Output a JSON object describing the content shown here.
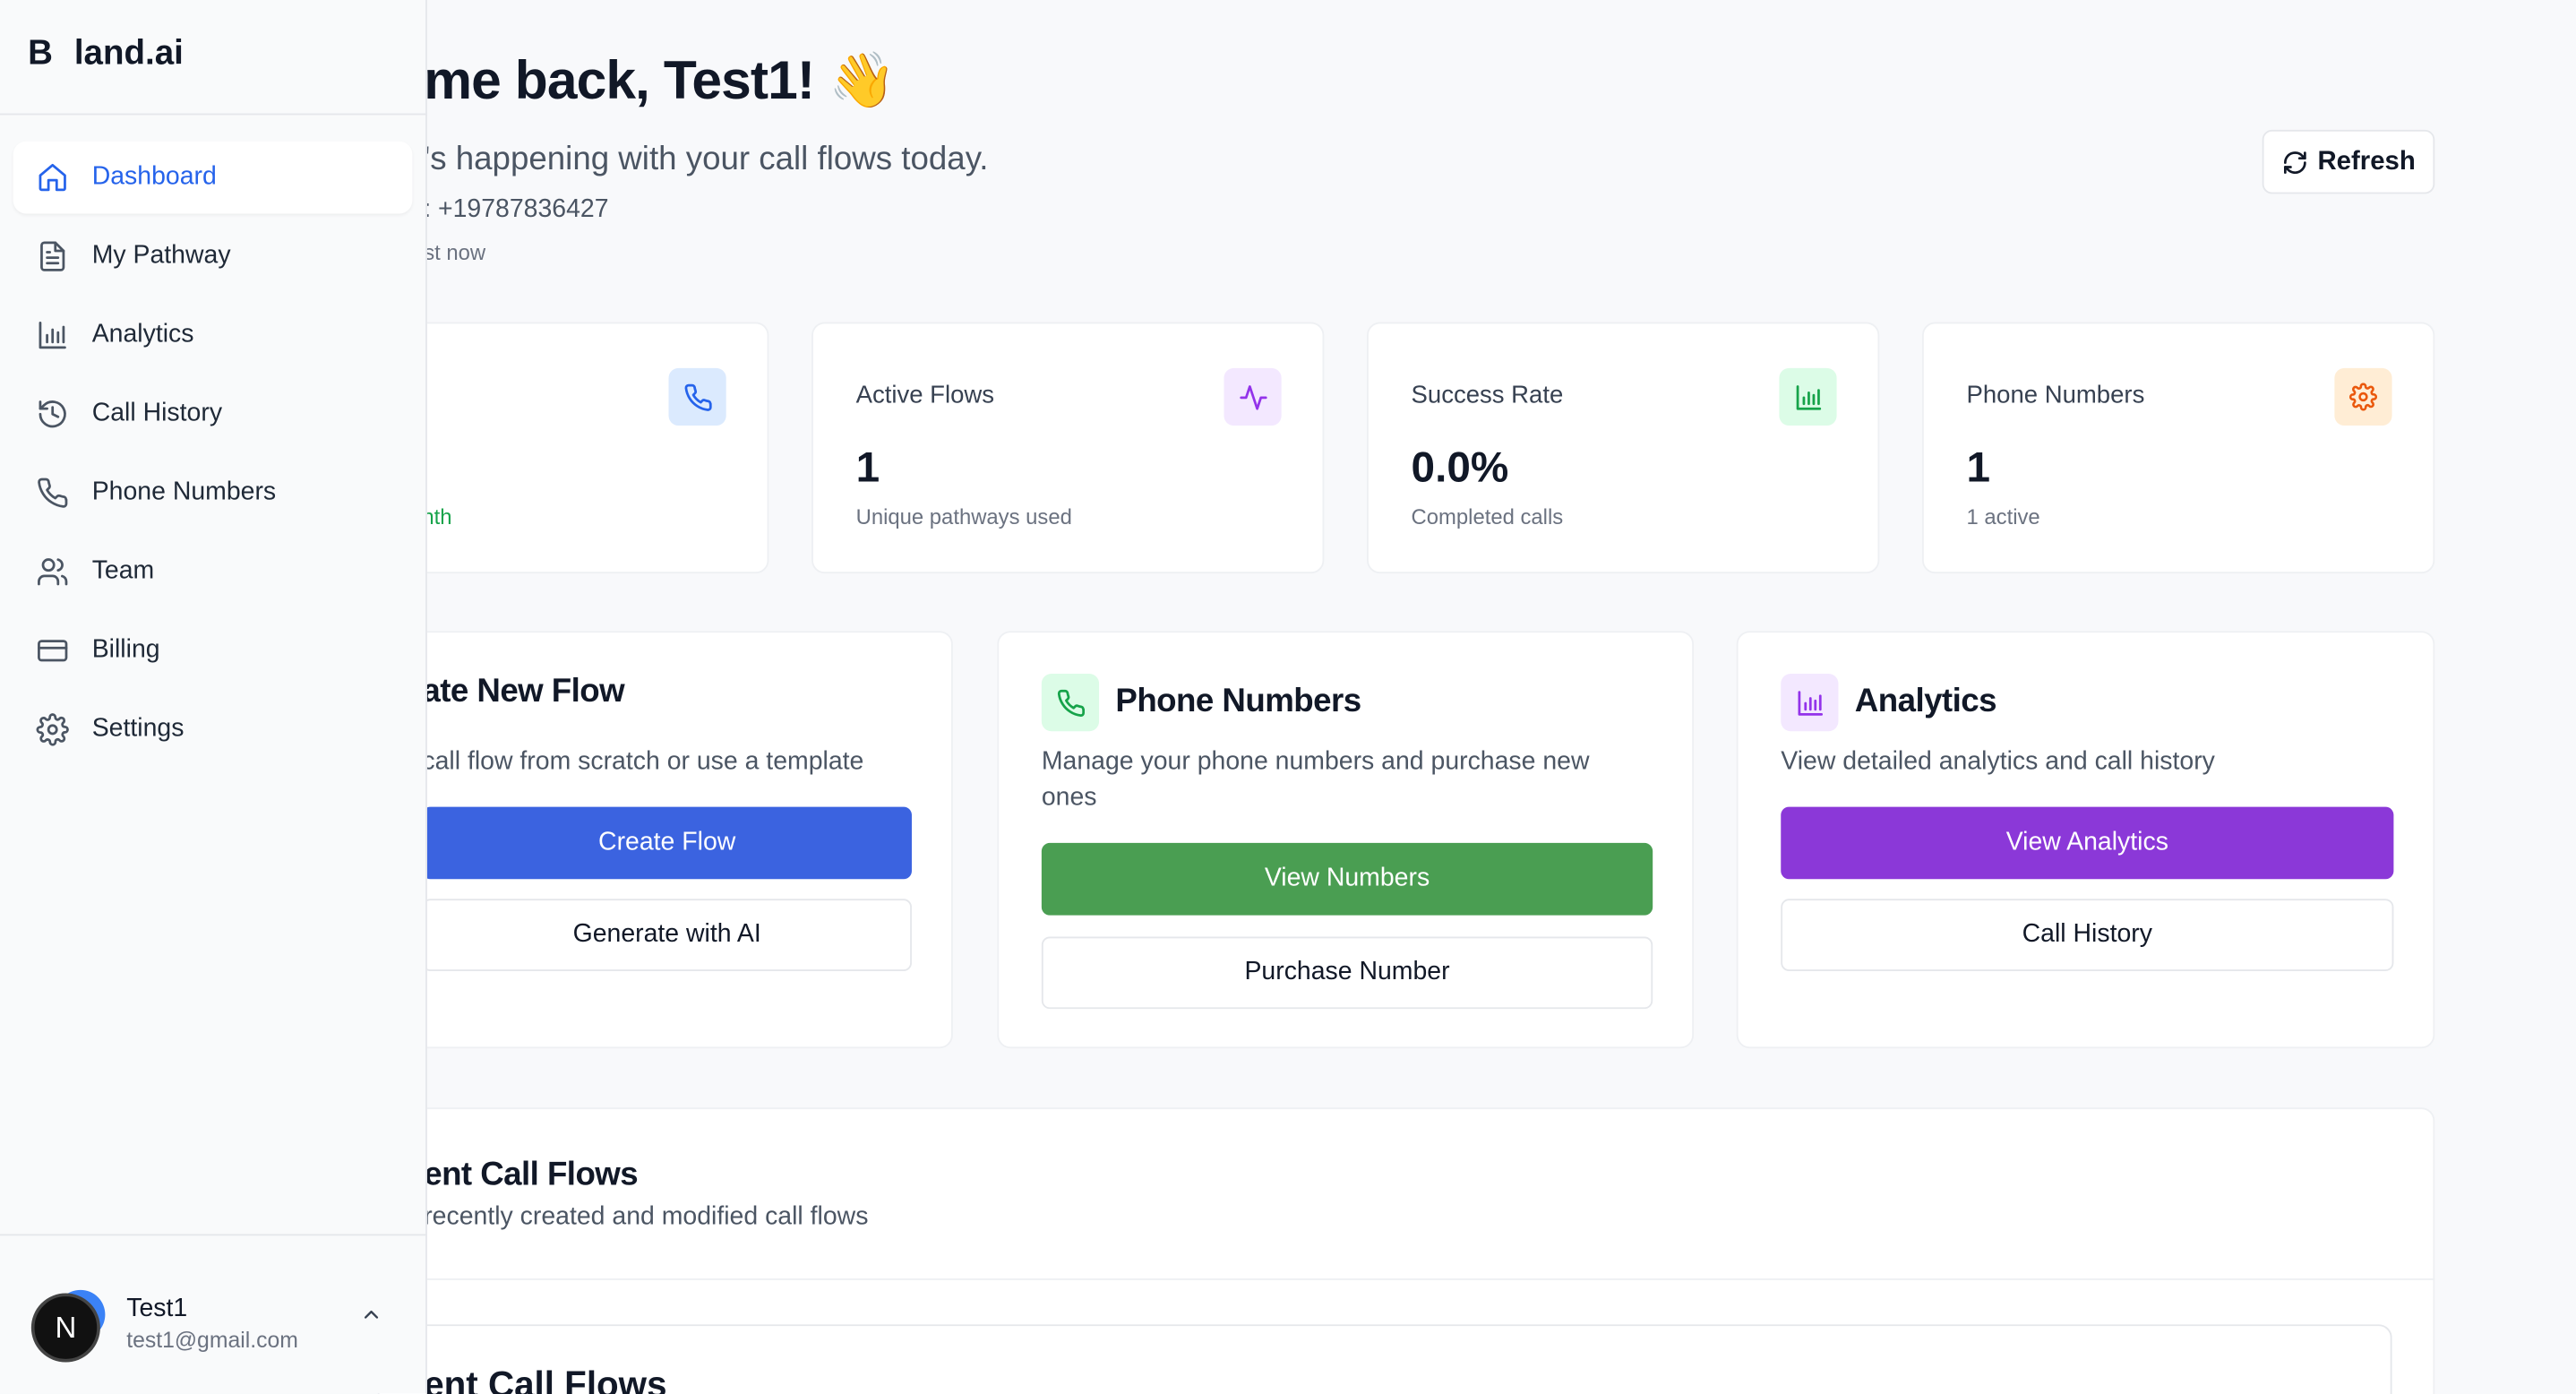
{
  "brand": {
    "mark": "B",
    "name": "land.ai"
  },
  "sidebar": {
    "items": [
      {
        "label": "Dashboard",
        "icon": "home-icon",
        "active": true
      },
      {
        "label": "My Pathway",
        "icon": "file-text-icon"
      },
      {
        "label": "Analytics",
        "icon": "bar-chart-icon"
      },
      {
        "label": "Call History",
        "icon": "history-icon"
      },
      {
        "label": "Phone Numbers",
        "icon": "phone-icon"
      },
      {
        "label": "Team",
        "icon": "users-icon"
      },
      {
        "label": "Billing",
        "icon": "credit-card-icon"
      },
      {
        "label": "Settings",
        "icon": "gear-icon"
      }
    ],
    "user": {
      "initial": "N",
      "name": "Test1",
      "email": "test1@gmail.com"
    }
  },
  "header": {
    "greeting": "me back, Test1! 👋",
    "subtitle": "'s happening with your call flows today.",
    "phone": ": +19787836427",
    "updated": "st now",
    "refresh_label": "Refresh"
  },
  "stats": [
    {
      "label": "",
      "value": "",
      "note": "nth",
      "icon": "phone-icon",
      "color": "#2563eb",
      "bg": "#dbeafe"
    },
    {
      "label": "Active Flows",
      "value": "1",
      "note": "Unique pathways used",
      "icon": "activity-icon",
      "color": "#9333ea",
      "bg": "#f3e8ff"
    },
    {
      "label": "Success Rate",
      "value": "0.0%",
      "note": "Completed calls",
      "icon": "bar-chart-icon",
      "color": "#16a34a",
      "bg": "#dcfce7"
    },
    {
      "label": "Phone Numbers",
      "value": "1",
      "note": "1 active",
      "icon": "gear-icon",
      "color": "#ea580c",
      "bg": "#ffedd5"
    }
  ],
  "actions": {
    "create": {
      "title": "ate New Flow",
      "desc": "call flow from scratch or use a template",
      "primary": "Create Flow",
      "secondary": "Generate with AI",
      "color": "#3b63e0"
    },
    "phones": {
      "title": "Phone Numbers",
      "desc": "Manage your phone numbers and purchase new ones",
      "primary": "View Numbers",
      "secondary": "Purchase Number",
      "color": "#4a9e52",
      "icon_bg": "#dcfce7"
    },
    "analytics": {
      "title": "Analytics",
      "desc": "View detailed analytics and call history",
      "primary": "View Analytics",
      "secondary": "Call History",
      "color": "#8b38d8",
      "icon_bg": "#f3e8ff"
    }
  },
  "recent": {
    "title": "ent Call Flows",
    "subtitle": "recently created and modified call flows",
    "inner_title": "ent Call Flows"
  }
}
